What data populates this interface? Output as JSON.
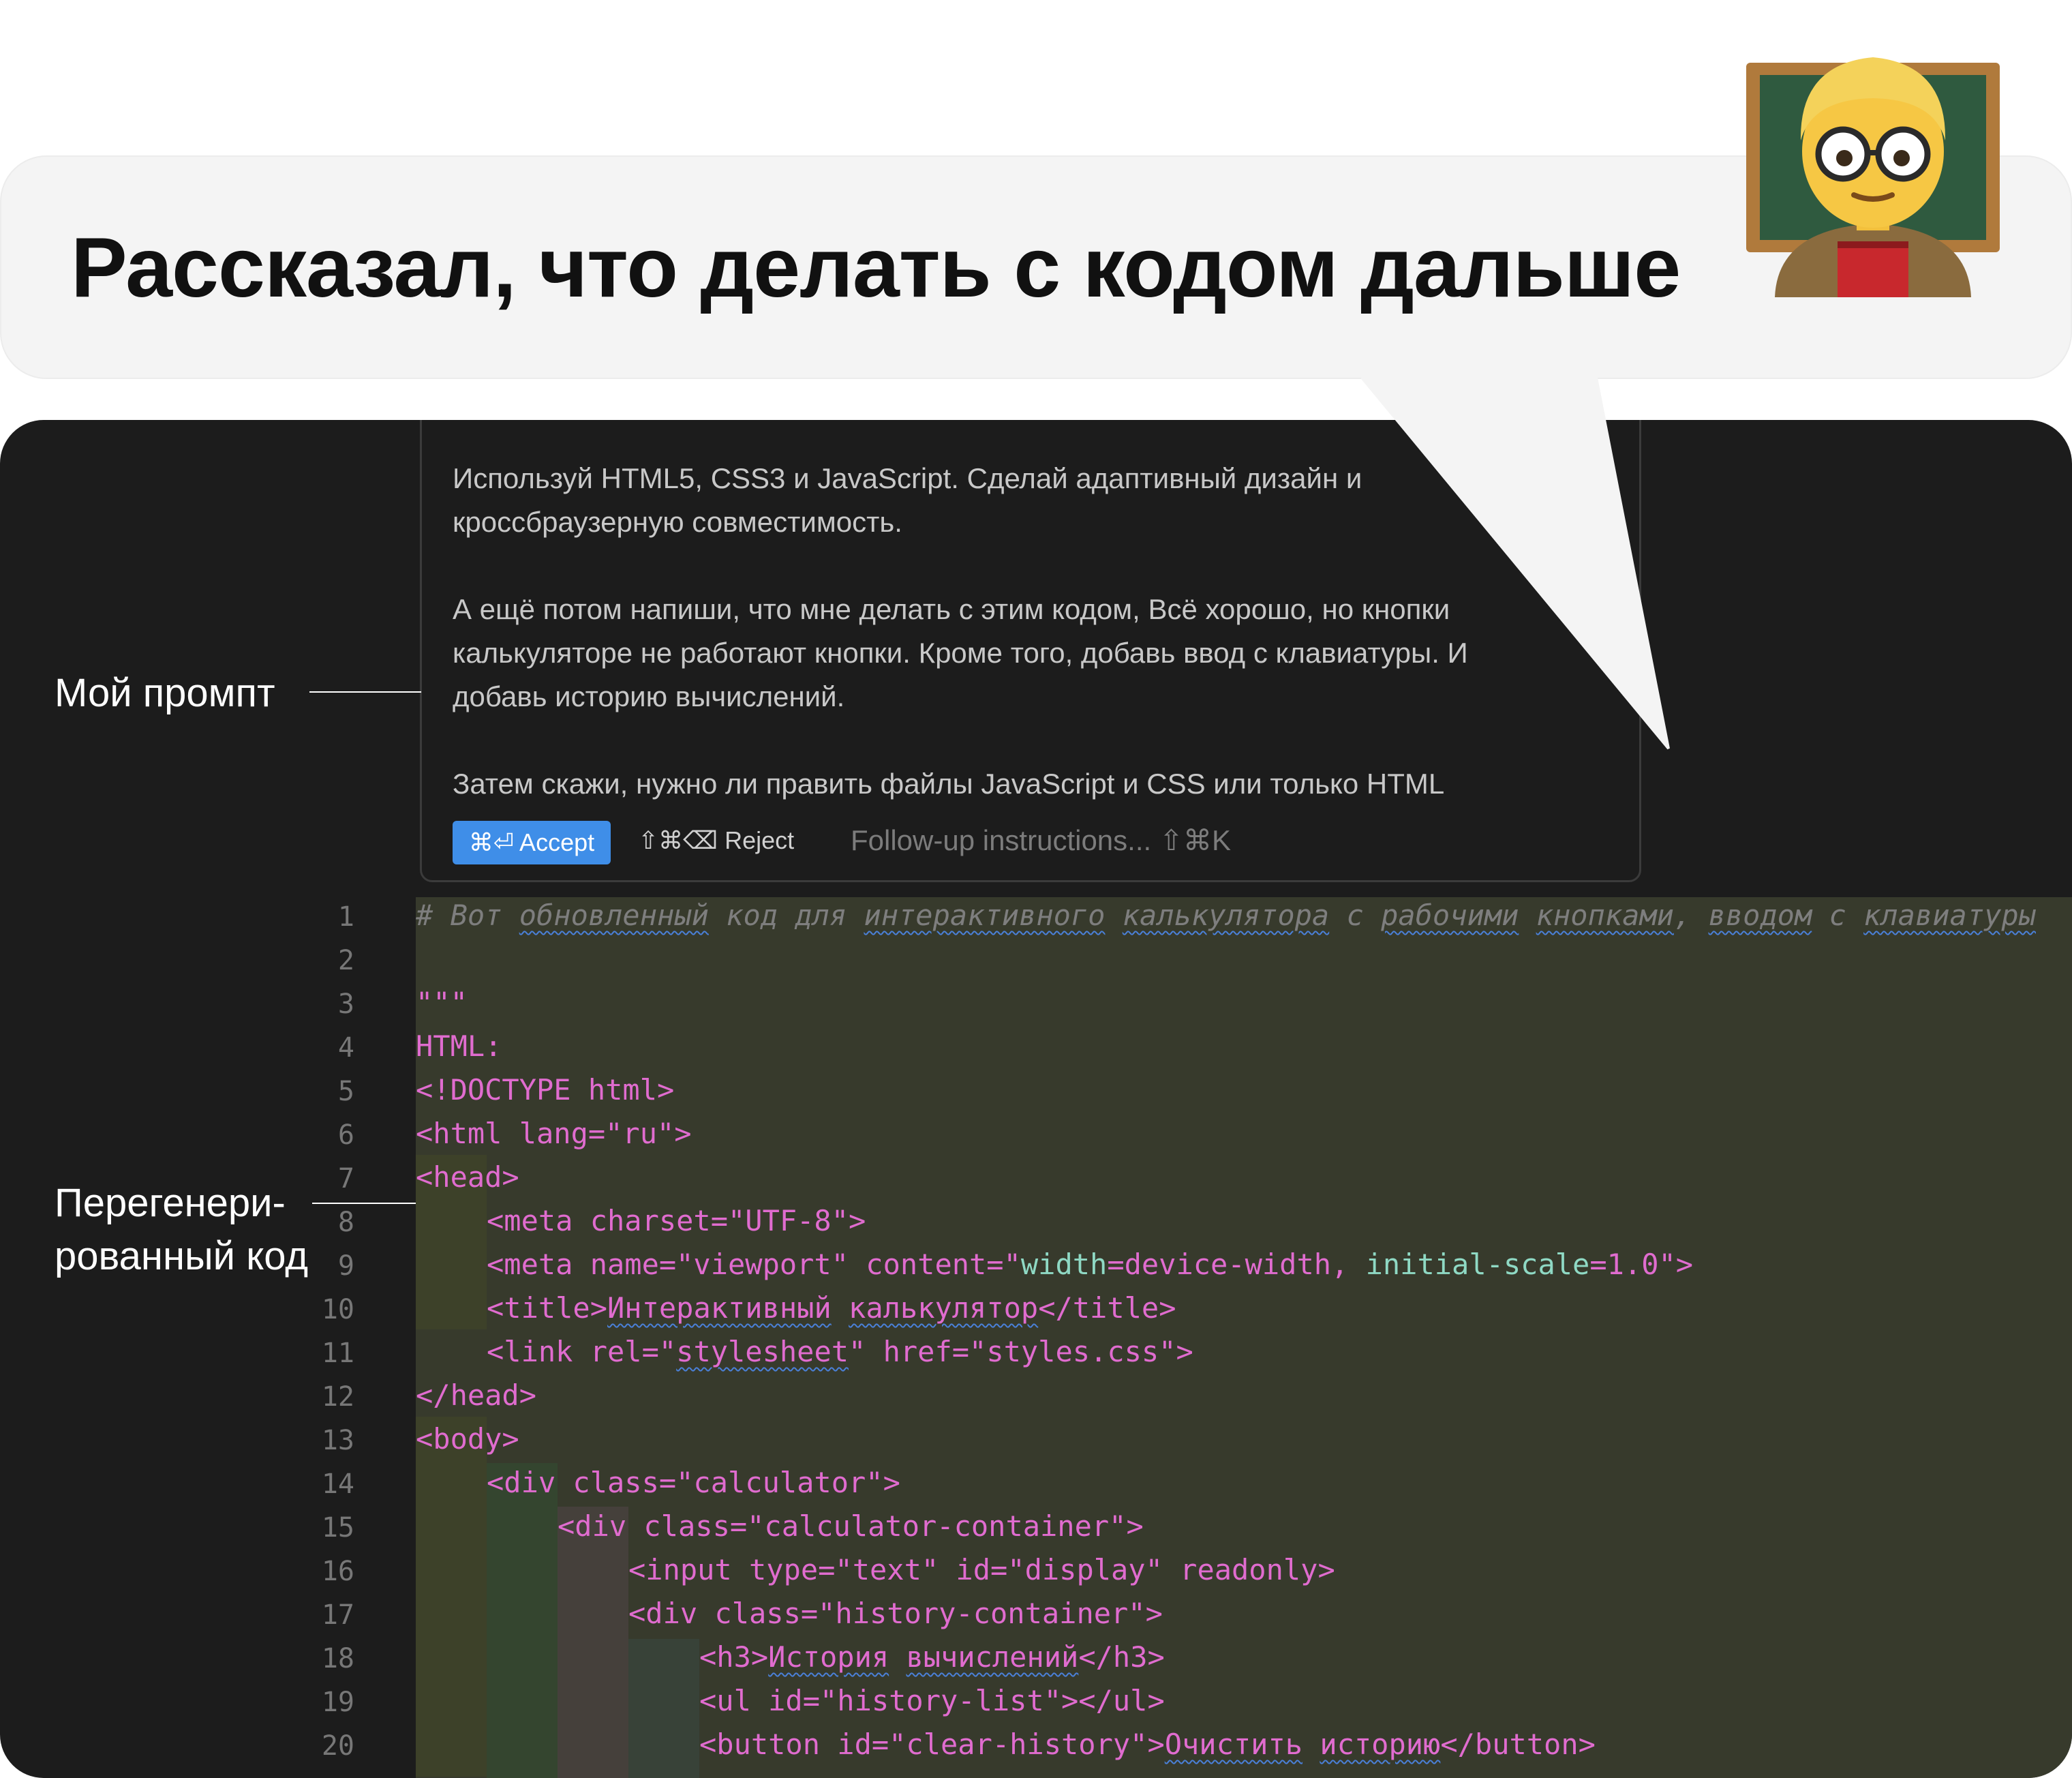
{
  "bubble": {
    "title": "Рассказал, что делать с кодом дальше"
  },
  "avatar": {
    "icon": "teacher-emoji"
  },
  "annotations": {
    "prompt_label": "Мой промпт",
    "code_label_1": "Перегенери-",
    "code_label_2": "рованный код"
  },
  "prompt": {
    "lines": [
      "Используй HTML5, CSS3 и JavaScript. Сделай адаптивный дизайн и",
      "кроссбраузерную совместимость.",
      "",
      "А ещё потом напиши, что мне делать с этим кодом, Всё хорошо, но кнопки",
      "калькуляторе не работают кнопки. Кроме того, добавь ввод с клавиатуры. И",
      "добавь историю вычислений.",
      "",
      "Затем скажи, нужно ли править файлы JavaScript и CSS или только HTML"
    ],
    "accept_label": "⌘⏎ Accept",
    "reject_label": "⇧⌘⌫ Reject",
    "followup_placeholder": "Follow-up instructions... ⇧⌘K"
  },
  "code": {
    "line_numbers": [
      "1",
      "2",
      "3",
      "4",
      "5",
      "6",
      "7",
      "8",
      "9",
      "10",
      "11",
      "12",
      "13",
      "14",
      "15",
      "16",
      "17",
      "18",
      "19",
      "20"
    ],
    "lines": {
      "l1_a": "# Вот ",
      "l1_b": "обновленный",
      "l1_c": " код для ",
      "l1_d": "интерактивного",
      "l1_e": " ",
      "l1_f": "калькулятора",
      "l1_g": " с ",
      "l1_h": "рабочими",
      "l1_i": " ",
      "l1_j": "кнопками",
      "l1_k": ", ",
      "l1_l": "вводом",
      "l1_m": " с ",
      "l1_n": "клавиатуры",
      "l3": "\"\"\"",
      "l4": "HTML:",
      "l5": "<!DOCTYPE html>",
      "l6": "<html lang=\"ru\">",
      "l7": "<head>",
      "l8": "<meta charset=\"UTF-8\">",
      "l9_a": "<meta name=\"viewport\" content=\"",
      "l9_b": "width",
      "l9_c": "=device-width, ",
      "l9_d": "initial-scale",
      "l9_e": "=1.0\">",
      "l10_a": "<title>",
      "l10_b": "Интерактивный",
      "l10_c": " ",
      "l10_d": "калькулятор",
      "l10_e": "</title>",
      "l11_a": "<link rel=\"",
      "l11_b": "stylesheet",
      "l11_c": "\" href=\"styles.css\">",
      "l12": "</head>",
      "l13": "<body>",
      "l14": "<div class=\"calculator\">",
      "l15": "<div class=\"calculator-container\">",
      "l16": "<input type=\"text\" id=\"display\" readonly>",
      "l17": "<div class=\"history-container\">",
      "l18_a": "<h3>",
      "l18_b": "История",
      "l18_c": " ",
      "l18_d": "вычислений",
      "l18_e": "</h3>",
      "l19": "<ul id=\"history-list\"></ul>",
      "l20_a": "<button id=\"clear-history\">",
      "l20_b": "Очистить",
      "l20_c": " ",
      "l20_d": "историю",
      "l20_e": "</button>"
    }
  }
}
